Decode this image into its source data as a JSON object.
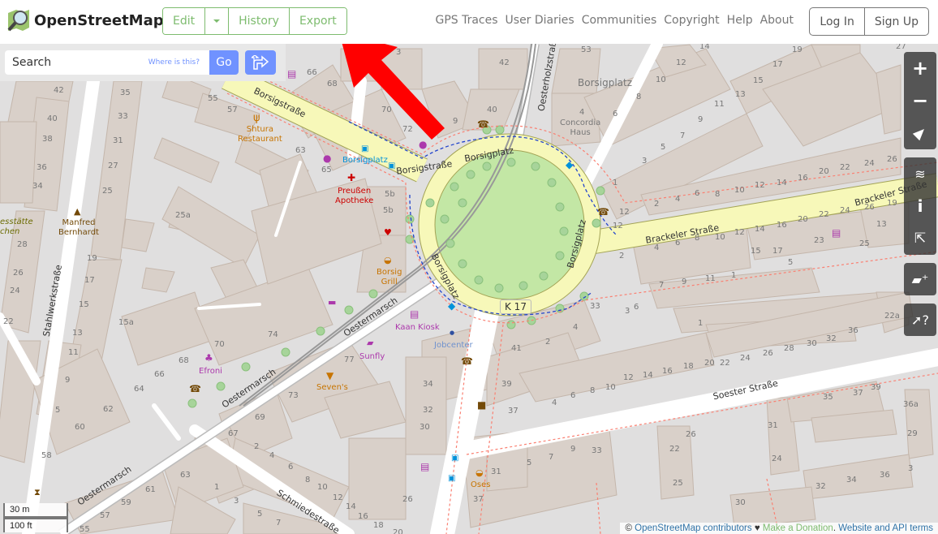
{
  "header": {
    "title": "OpenStreetMap",
    "edit_buttons": [
      "Edit",
      "History",
      "Export"
    ],
    "nav_links": [
      "GPS Traces",
      "User Diaries",
      "Communities",
      "Copyright",
      "Help",
      "About"
    ],
    "auth_buttons": [
      "Log In",
      "Sign Up"
    ]
  },
  "search": {
    "placeholder": "Search",
    "where_link": "Where is this?",
    "go_label": "Go",
    "directions_icon": "directions-icon"
  },
  "map_controls": [
    "zoom-in-icon",
    "zoom-out-icon",
    "locate-icon",
    "layers-icon",
    "info-icon",
    "share-icon",
    "add-note-icon",
    "query-features-icon"
  ],
  "scale": {
    "metric": "30 m",
    "imperial": "100 ft"
  },
  "attribution": {
    "copyright": "©",
    "contributors": "OpenStreetMap contributors",
    "heart": "♥",
    "donate": "Make a Donation",
    "sep": ".",
    "terms": "Website and API terms"
  },
  "map": {
    "streets": [
      "Borsigstraße",
      "Borsigstraße",
      "Borsigplatz",
      "Borsigplatz",
      "Borsigplatz",
      "Brackeler Straße",
      "Brackeler Straße",
      "Oesterholzstraße",
      "Stahlwerkstraße",
      "Oestermarsch",
      "Oestermarsch",
      "Oestermarsch",
      "Soester Straße",
      "Schmiedestraße"
    ],
    "road_ref": "K 17",
    "place_label": "Borsigplatz",
    "pois": [
      {
        "name": "Shtura\nRestaurant",
        "color": "#c77400"
      },
      {
        "name": "Borsigplatz",
        "color": "#0092da"
      },
      {
        "name": "Preußen\nApotheke",
        "color": "#c00"
      },
      {
        "name": "Manfred\nBernhardt",
        "color": "#734a08"
      },
      {
        "name": "Borsig\nGrill",
        "color": "#c77400"
      },
      {
        "name": "Kaan Kiosk",
        "color": "#ac39ac"
      },
      {
        "name": "Jobcenter",
        "color": "#7092ce"
      },
      {
        "name": "Sunfly",
        "color": "#ac39ac"
      },
      {
        "name": "Efroni",
        "color": "#ac39ac"
      },
      {
        "name": "Seven's",
        "color": "#c77400"
      },
      {
        "name": "Oses",
        "color": "#c77400"
      },
      {
        "name": "Concordia\nHaus",
        "color": "#777"
      },
      {
        "name": "esstätte\nchen",
        "color": "#6b6b00"
      }
    ],
    "house_numbers": [
      "3",
      "42",
      "53",
      "12",
      "14",
      "17",
      "19",
      "27",
      "35",
      "33",
      "31",
      "27",
      "25",
      "42",
      "40",
      "38",
      "36",
      "34",
      "55",
      "57",
      "66",
      "68",
      "70",
      "72",
      "9",
      "40",
      "63",
      "65",
      "5b",
      "5b",
      "10",
      "8",
      "6",
      "4",
      "15",
      "13",
      "11",
      "9",
      "7",
      "5",
      "3",
      "1",
      "12",
      "2",
      "4",
      "6",
      "8",
      "10",
      "12",
      "14",
      "16",
      "20",
      "22",
      "24",
      "26",
      "25a",
      "28",
      "26",
      "24",
      "22",
      "19",
      "17",
      "15",
      "13",
      "15a",
      "11",
      "9",
      "5",
      "62",
      "60",
      "58",
      "74",
      "70",
      "68",
      "66",
      "64",
      "73",
      "77",
      "69",
      "67",
      "2",
      "4",
      "6",
      "8",
      "10",
      "12",
      "14",
      "16",
      "18",
      "20",
      "63",
      "61",
      "59",
      "57",
      "55",
      "1",
      "3",
      "5",
      "7",
      "34",
      "32",
      "30",
      "26",
      "41",
      "2",
      "4",
      "39",
      "37",
      "4",
      "6",
      "8",
      "10",
      "12",
      "14",
      "16",
      "18",
      "20",
      "22",
      "24",
      "26",
      "28",
      "30",
      "32",
      "36",
      "22a",
      "1",
      "12",
      "2",
      "4",
      "6",
      "8",
      "10",
      "12",
      "14",
      "16",
      "20",
      "22",
      "24",
      "26",
      "19",
      "23",
      "25",
      "13",
      "15",
      "17",
      "5",
      "7",
      "9",
      "11",
      "1",
      "3",
      "6",
      "33",
      "35",
      "37",
      "39",
      "36a",
      "29",
      "31",
      "24",
      "22",
      "25",
      "26",
      "30",
      "32",
      "34",
      "36",
      "3",
      "5",
      "7",
      "9",
      "33",
      "31",
      "37"
    ]
  }
}
